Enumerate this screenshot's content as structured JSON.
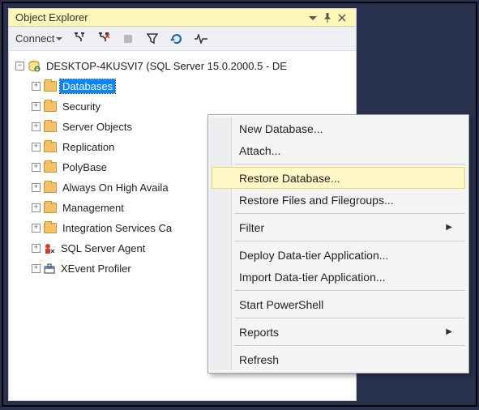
{
  "title": "Object Explorer",
  "toolbar": {
    "connect_label": "Connect"
  },
  "tree": {
    "server": "DESKTOP-4KUSVI7 (SQL Server 15.0.2000.5 - DE",
    "items": [
      "Databases",
      "Security",
      "Server Objects",
      "Replication",
      "PolyBase",
      "Always On High Availa",
      "Management",
      "Integration Services Ca",
      "SQL Server Agent",
      "XEvent Profiler"
    ]
  },
  "menu": {
    "new_database": "New Database...",
    "attach": "Attach...",
    "restore_database": "Restore Database...",
    "restore_files": "Restore Files and Filegroups...",
    "filter": "Filter",
    "deploy": "Deploy Data-tier Application...",
    "import": "Import Data-tier Application...",
    "start_ps": "Start PowerShell",
    "reports": "Reports",
    "refresh": "Refresh"
  }
}
